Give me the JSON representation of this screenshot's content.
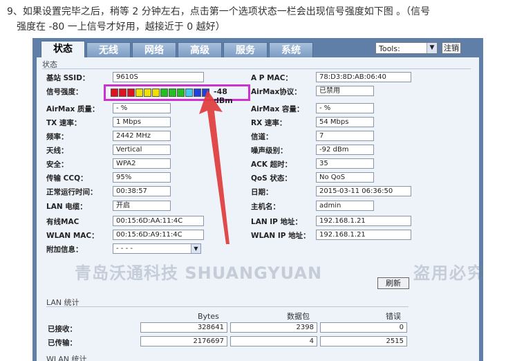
{
  "instruction": {
    "line1": "9、如果设置完毕之后，稍等 2 分钟左右，点击第一个选项状态一栏会出现信号强度如下图 。（信号",
    "line2": "强度在 -80 一上信号才好用，越接近于 0 越好）"
  },
  "tabs": [
    "状态",
    "无线",
    "网络",
    "高级",
    "服务",
    "系统"
  ],
  "tools": {
    "label": "Tools:"
  },
  "logout_label": "注销",
  "status_section": "状态",
  "left_fields": {
    "ssid": {
      "label": "基站 SSID：",
      "value": "9610S"
    },
    "signal": {
      "label": "信号强度：",
      "value": "-48 dBm"
    },
    "airmax_quality": {
      "label": "AirMax 质量：",
      "value": "- %"
    },
    "tx_rate": {
      "label": "TX 速率：",
      "value": "1 Mbps"
    },
    "frequency": {
      "label": "频率：",
      "value": "2442 MHz"
    },
    "antenna": {
      "label": "天线：",
      "value": "Vertical"
    },
    "security": {
      "label": "安全：",
      "value": "WPA2"
    },
    "ccq": {
      "label": "传输 CCQ：",
      "value": "95%"
    },
    "uptime": {
      "label": "正常运行时间：",
      "value": "00:38:57"
    },
    "lan_cable": {
      "label": "LAN 电缆：",
      "value": "开启"
    },
    "wired_mac": {
      "label": "有线MAC",
      "value": "00:15:6D:AA:11:4C"
    },
    "wlan_mac": {
      "label": "WLAN MAC：",
      "value": "00:15:6D:A9:11:4C"
    },
    "extra": {
      "label": "附加信息：",
      "value": "- - - -"
    }
  },
  "right_fields": {
    "ap_mac": {
      "label": "A P MAC：",
      "value": "78:D3:8D:AB:06:40"
    },
    "airmax_protocol": {
      "label": "AirMax协议：",
      "value": "已禁用"
    },
    "airmax_capacity": {
      "label": "AirMax 容量：",
      "value": "- %"
    },
    "rx_rate": {
      "label": "RX 速率：",
      "value": "54 Mbps"
    },
    "channel": {
      "label": "信道：",
      "value": "7"
    },
    "noise": {
      "label": "噪声级别：",
      "value": "-92 dBm"
    },
    "ack_timeout": {
      "label": "ACK 超时：",
      "value": "35"
    },
    "qos": {
      "label": "QoS 状态：",
      "value": "No QoS"
    },
    "date": {
      "label": "日期：",
      "value": "2015-03-11 06:36:50"
    },
    "hostname": {
      "label": "主机名：",
      "value": "admin"
    },
    "lan_ip": {
      "label": "LAN IP 地址：",
      "value": "192.168.1.21"
    },
    "wlan_ip": {
      "label": "WLAN IP 地址：",
      "value": "192.168.1.21"
    }
  },
  "signal_bars": {
    "total": 12,
    "lit": 12,
    "colors": [
      "#e01020",
      "#e01020",
      "#e01020",
      "#f0e000",
      "#f0e000",
      "#f0e000",
      "#20c020",
      "#20c020",
      "#20c020",
      "#40c8f0",
      "#2040e0",
      "#2040e0"
    ]
  },
  "refresh_label": "刷新",
  "lan_stats": {
    "title": "LAN 统计",
    "headers": [
      "Bytes",
      "数据包",
      "错误"
    ],
    "rows": [
      {
        "label": "已接收：",
        "values": [
          "328641",
          "2398",
          "0"
        ]
      },
      {
        "label": "已传输：",
        "values": [
          "2176697",
          "4",
          "2515"
        ]
      }
    ]
  },
  "wlan_stats": {
    "title": "WLAN 统计"
  },
  "watermark": {
    "left": "青岛沃通科技  SHUANGYUAN",
    "right": "盗用必究"
  },
  "colors": {
    "frame": "#5f7fa8",
    "panel": "#eef3fa",
    "highlight": "#cc33cc",
    "arrow": "#e03c3c"
  }
}
